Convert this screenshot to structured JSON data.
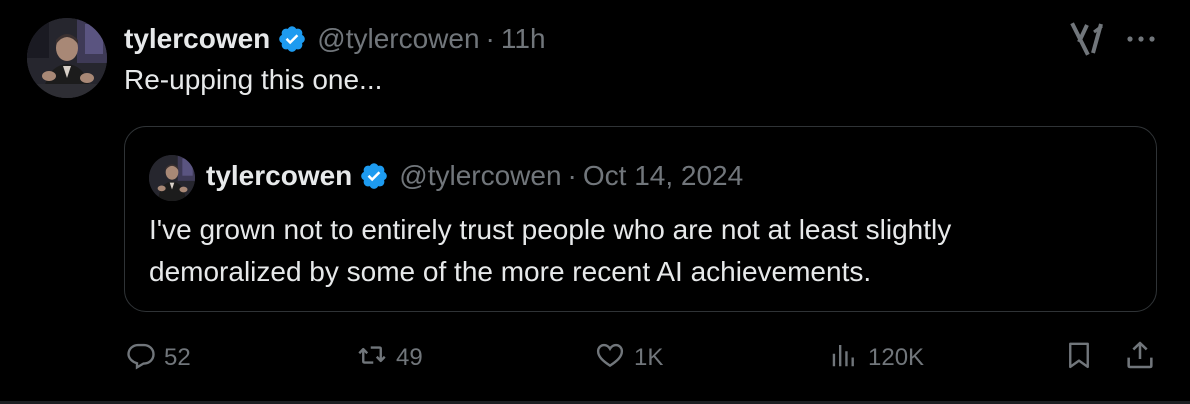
{
  "tweet": {
    "author_name": "tylercowen",
    "author_handle": "@tylercowen",
    "separator": "·",
    "time": "11h",
    "text": "Re-upping this one..."
  },
  "quoted_tweet": {
    "author_name": "tylercowen",
    "author_handle": "@tylercowen",
    "separator": "·",
    "date": "Oct 14, 2024",
    "text_line_1": "I've grown not to entirely trust people who are not at least slightly",
    "text_line_2": "demoralized by some of the more recent AI achievements."
  },
  "actions": {
    "replies": "52",
    "reposts": "49",
    "likes": "1K",
    "views": "120K"
  },
  "icons": {
    "verified": "verified-badge-icon",
    "grok": "grok-icon",
    "more": "more-icon",
    "reply": "reply-icon",
    "repost": "repost-icon",
    "like": "heart-icon",
    "views": "views-icon",
    "bookmark": "bookmark-icon",
    "share": "share-icon"
  },
  "colors": {
    "background": "#000000",
    "text_primary": "#e7e9ea",
    "text_secondary": "#71767b",
    "verified_blue": "#1d9bf0",
    "border": "#2f3336"
  }
}
